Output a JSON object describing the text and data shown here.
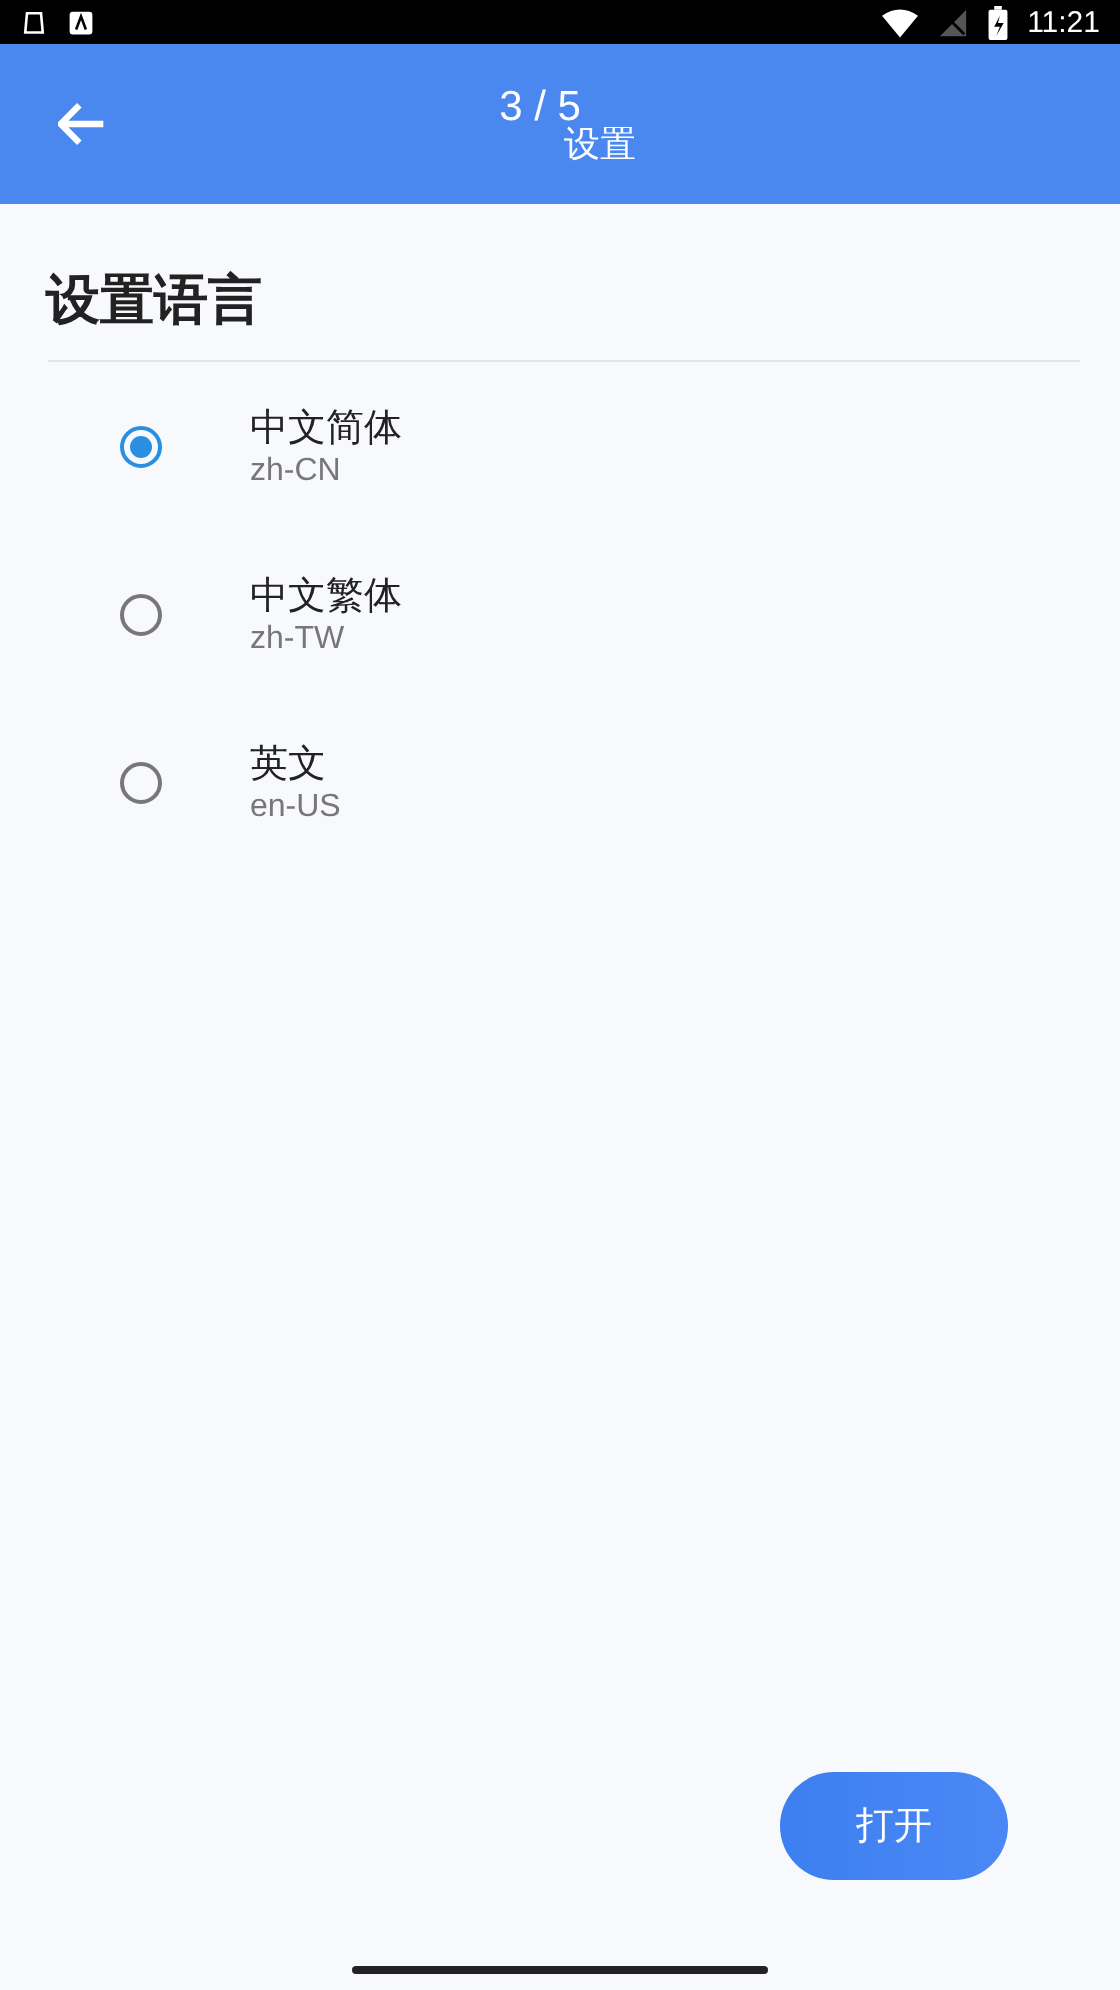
{
  "status_bar": {
    "time": "11:21"
  },
  "app_bar": {
    "step": "3 / 5",
    "title": "设置"
  },
  "section": {
    "title": "设置语言"
  },
  "languages": [
    {
      "name": "中文简体",
      "code": "zh-CN",
      "selected": true
    },
    {
      "name": "中文繁体",
      "code": "zh-TW",
      "selected": false
    },
    {
      "name": "英文",
      "code": "en-US",
      "selected": false
    }
  ],
  "buttons": {
    "open": "打开"
  }
}
